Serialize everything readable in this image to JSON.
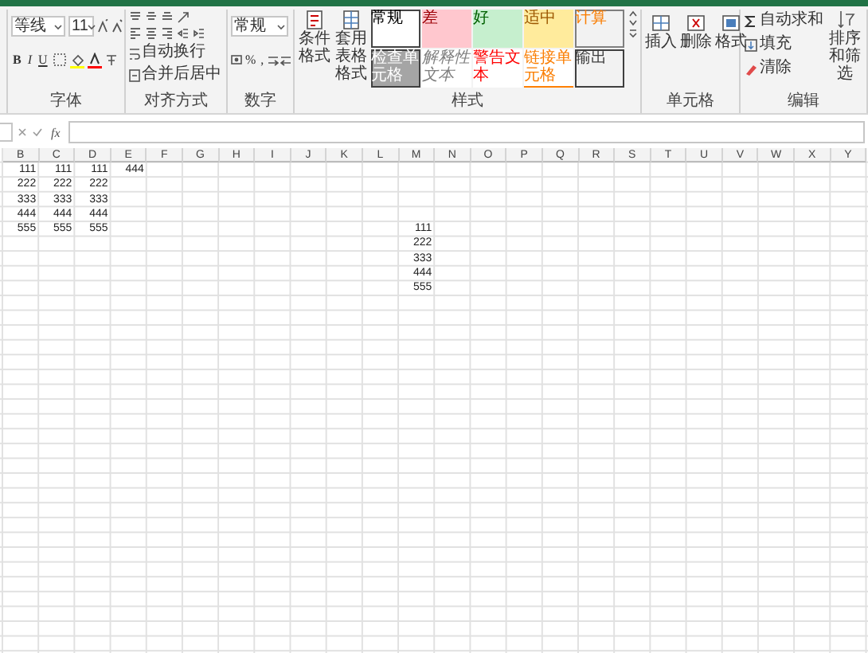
{
  "ribbon": {
    "groups": [
      {
        "kind": "font",
        "label": "字体",
        "font_name": "等线",
        "font_size": "11",
        "format_buttons": [
          "B",
          "I",
          "U"
        ]
      },
      {
        "kind": "alignment",
        "label": "对齐方式",
        "buttons": [
          "自动换行",
          "合并后居中"
        ]
      },
      {
        "kind": "number",
        "label": "数字",
        "format": "常规",
        "symbols": [
          "%",
          ","
        ]
      },
      {
        "kind": "styles",
        "label": "样式",
        "buttons": [
          "条件格式",
          "套用表格格式"
        ],
        "cell_styles": [
          {
            "label": "常规",
            "kind": "normal"
          },
          {
            "label": "差",
            "kind": "bad"
          },
          {
            "label": "好",
            "kind": "good"
          },
          {
            "label": "适中",
            "kind": "neutral"
          },
          {
            "label": "计算",
            "kind": "calculation"
          },
          {
            "label": "检查单元格",
            "kind": "check"
          },
          {
            "label": "解释性文本",
            "kind": "explanatory"
          },
          {
            "label": "警告文本",
            "kind": "warning"
          },
          {
            "label": "链接单元格",
            "kind": "linked"
          },
          {
            "label": "输出",
            "kind": "output"
          }
        ]
      },
      {
        "kind": "cells",
        "label": "单元格",
        "buttons": [
          "插入",
          "删除",
          "格式"
        ]
      },
      {
        "kind": "editing",
        "label": "编辑",
        "buttons": [
          "自动求和",
          "填充",
          "清除"
        ],
        "sort": "排序和筛选"
      }
    ]
  },
  "formula_bar": {
    "function_label": "fx"
  },
  "sheet": {
    "columns": [
      "B",
      "C",
      "D",
      "E",
      "F",
      "G",
      "H",
      "I",
      "J",
      "K",
      "L",
      "M",
      "N",
      "O",
      "P",
      "Q",
      "R",
      "S",
      "T",
      "U",
      "V",
      "W",
      "X",
      "Y"
    ],
    "rows": [
      {
        "B": "111",
        "C": "111",
        "D": "111",
        "E": "444"
      },
      {
        "B": "222",
        "C": "222",
        "D": "222"
      },
      {
        "B": "333",
        "C": "333",
        "D": "333"
      },
      {
        "B": "444",
        "C": "444",
        "D": "444"
      },
      {
        "B": "555",
        "C": "555",
        "D": "555",
        "M": "111"
      },
      {
        "M": "222"
      },
      {
        "M": "333"
      },
      {
        "M": "444"
      },
      {
        "M": "555"
      }
    ]
  }
}
